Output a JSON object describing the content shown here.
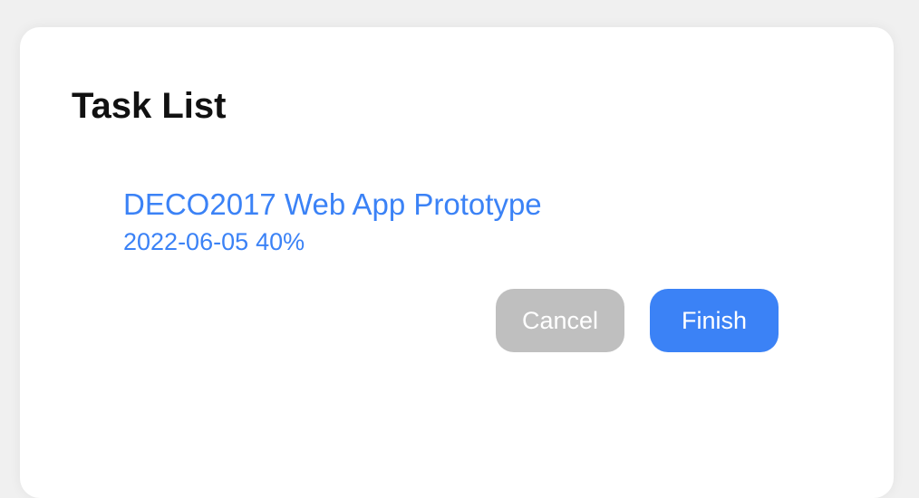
{
  "panel": {
    "title": "Task List"
  },
  "task": {
    "name": "DECO2017 Web App Prototype",
    "date": "2022-06-05",
    "progress": "40%"
  },
  "actions": {
    "cancel_label": "Cancel",
    "finish_label": "Finish"
  },
  "colors": {
    "accent": "#3b82f6",
    "cancel": "#bfbfbf"
  }
}
